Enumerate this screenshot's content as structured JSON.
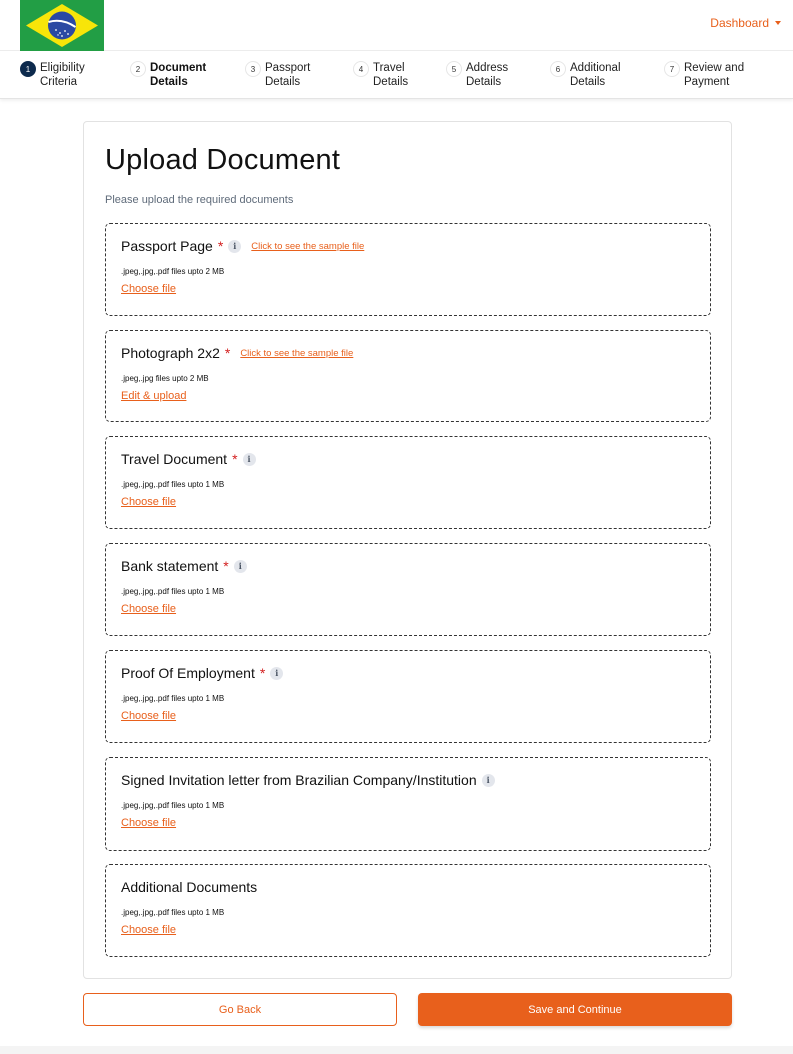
{
  "header": {
    "flag_icon": "brazil-flag-icon",
    "dashboard_label": "Dashboard",
    "accent_color": "#e8601c"
  },
  "stepper": {
    "steps": [
      {
        "number": "1",
        "line1": "Eligibility",
        "line2": "Criteria"
      },
      {
        "number": "2",
        "line1": "Document",
        "line2": "Details"
      },
      {
        "number": "3",
        "line1": "Passport",
        "line2": "Details"
      },
      {
        "number": "4",
        "line1": "Travel",
        "line2": "Details"
      },
      {
        "number": "5",
        "line1": "Address",
        "line2": "Details"
      },
      {
        "number": "6",
        "line1": "Additional",
        "line2": "Details"
      },
      {
        "number": "7",
        "line1": "Review and",
        "line2": "Payment"
      }
    ]
  },
  "main": {
    "title": "Upload Document",
    "subtitle": "Please upload the required documents"
  },
  "documents": [
    {
      "title": "Passport Page",
      "required": "*",
      "sample_link": "Click to see the sample file",
      "hint": ".jpeg,.jpg,.pdf files upto 2 MB",
      "action": "Choose file"
    },
    {
      "title": "Photograph 2x2",
      "required": "*",
      "sample_link": "Click to see the sample file",
      "hint": ".jpeg,.jpg files upto 2 MB",
      "action": "Edit & upload"
    },
    {
      "title": "Travel Document",
      "required": "*",
      "hint": ".jpeg,.jpg,.pdf files upto 1 MB",
      "action": "Choose file"
    },
    {
      "title": "Bank statement",
      "required": "*",
      "hint": ".jpeg,.jpg,.pdf files upto 1 MB",
      "action": "Choose file"
    },
    {
      "title": "Proof Of Employment",
      "required": "*",
      "hint": ".jpeg,.jpg,.pdf files upto 1 MB",
      "action": "Choose file"
    },
    {
      "title": "Signed Invitation letter from Brazilian Company/Institution",
      "hint": ".jpeg,.jpg,.pdf files upto 1 MB",
      "action": "Choose file"
    },
    {
      "title": "Additional Documents",
      "hint": ".jpeg,.jpg,.pdf files upto 1 MB",
      "action": "Choose file"
    }
  ],
  "info_icon_glyph": "i",
  "footer": {
    "back_label": "Go Back",
    "save_label": "Save and Continue"
  }
}
